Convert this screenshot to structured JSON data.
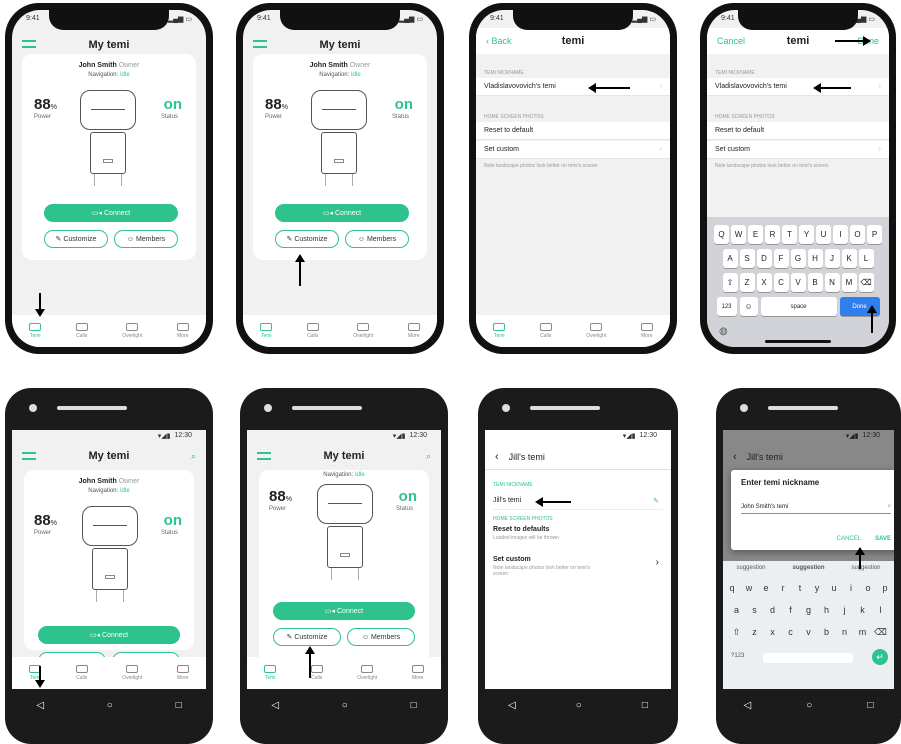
{
  "colors": {
    "accent": "#2ec28d",
    "frame": "#111111"
  },
  "status": {
    "ios_time": "9:41",
    "android_time": "12:30"
  },
  "home": {
    "title": "My temi",
    "owner_name": "John Smith",
    "owner_role": "Owner",
    "nav_label": "Navigation:",
    "nav_value": "Idle",
    "power_value": "88",
    "power_unit": "%",
    "power_label": "Power",
    "status_value": "on",
    "status_label": "Status",
    "connect": "Connect",
    "customize": "Customize",
    "members": "Members"
  },
  "tabs": [
    "Temi",
    "Calls",
    "Overlight",
    "More"
  ],
  "ios_settings": {
    "back": "Back",
    "cancel": "Cancel",
    "title": "temi",
    "done": "Done",
    "nick_section": "TEMI NICKNAME",
    "nickname": "Vladislavovovich's temi",
    "home_section": "HOME SCREEN PHOTOS",
    "reset": "Reset to default",
    "set_custom": "Set custom",
    "note": "Note landscape photos look better on temi's screen"
  },
  "keyboard": {
    "row1": [
      "Q",
      "W",
      "E",
      "R",
      "T",
      "Y",
      "U",
      "I",
      "O",
      "P"
    ],
    "row2": [
      "A",
      "S",
      "D",
      "F",
      "G",
      "H",
      "J",
      "K",
      "L"
    ],
    "row3": [
      "Z",
      "X",
      "C",
      "V",
      "B",
      "N",
      "M"
    ],
    "numbers": "123",
    "space": "space",
    "done": "Done"
  },
  "android_settings": {
    "title": "Jill's temi",
    "nick_section": "TEMI NICKNAME",
    "nickname": "Jill's temi",
    "home_section": "HOME SCREEN PHOTOS",
    "reset": "Reset to defaults",
    "reset_sub": "Loaded images will be thrown",
    "set_custom": "Set custom",
    "set_custom_sub": "Note landscape photos look better on temi's screen"
  },
  "dialog": {
    "title": "Enter temi nickname",
    "value": "John Smith's temi",
    "cancel": "CANCEL",
    "save": "SAVE"
  },
  "gkeyboard": {
    "suggestions": [
      "suggestion",
      "suggestion",
      "suggestion"
    ],
    "row1": [
      "q",
      "w",
      "e",
      "r",
      "t",
      "y",
      "u",
      "i",
      "o",
      "p"
    ],
    "row2": [
      "a",
      "s",
      "d",
      "f",
      "g",
      "h",
      "j",
      "k",
      "l"
    ],
    "row3": [
      "z",
      "x",
      "c",
      "v",
      "b",
      "n",
      "m"
    ],
    "numbers": "?123"
  }
}
